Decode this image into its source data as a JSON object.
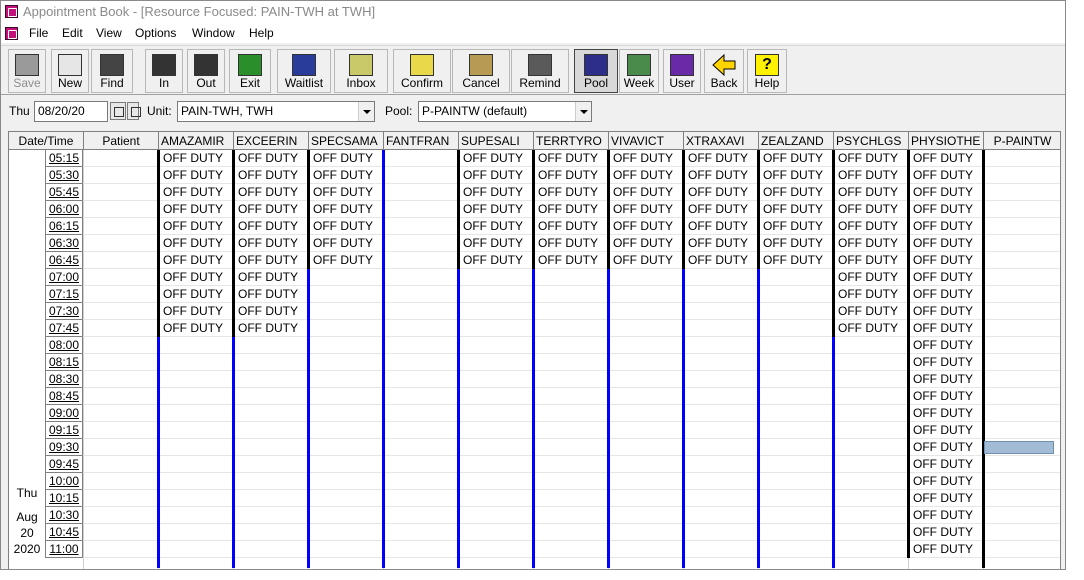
{
  "window": {
    "title": "Appointment Book - [Resource Focused:  PAIN-TWH at TWH]"
  },
  "menu": [
    "File",
    "Edit",
    "View",
    "Options",
    "Window",
    "Help"
  ],
  "toolbar": [
    {
      "label": "Save",
      "icon": "save-icon",
      "disabled": true
    },
    {
      "label": "New",
      "icon": "new-icon"
    },
    {
      "label": "Find",
      "icon": "binoculars-icon"
    },
    {
      "label": "In",
      "icon": "check-in-icon"
    },
    {
      "label": "Out",
      "icon": "check-out-icon"
    },
    {
      "label": "Exit",
      "icon": "exit-icon"
    },
    {
      "label": "Waitlist",
      "icon": "waitlist-icon"
    },
    {
      "label": "Inbox",
      "icon": "inbox-icon"
    },
    {
      "label": "Confirm",
      "icon": "confirm-icon"
    },
    {
      "label": "Cancel",
      "icon": "cancel-basket-icon"
    },
    {
      "label": "Remind",
      "icon": "remind-icon"
    },
    {
      "label": "Pool",
      "icon": "pool-grid-icon",
      "pressed": true
    },
    {
      "label": "Week",
      "icon": "week-grid-icon"
    },
    {
      "label": "User",
      "icon": "magnifier-icon"
    },
    {
      "label": "Back",
      "icon": "back-arrow-icon"
    },
    {
      "label": "Help",
      "icon": "help-question-icon"
    }
  ],
  "filters": {
    "day": "Thu",
    "date": "08/20/20",
    "unit_label": "Unit:",
    "unit_value": "PAIN-TWH, TWH",
    "pool_label": "Pool:",
    "pool_value": "P-PAINTW (default)"
  },
  "schedule": {
    "headers": {
      "datetime": "Date/Time",
      "patient": "Patient"
    },
    "resources": [
      "AMAZAMIR",
      "EXCEERIN",
      "SPECSAMA",
      "FANTFRAN",
      "SUPESALI",
      "TERRTYRO",
      "VIVAVICT",
      "XTRAXAVI",
      "ZEALZAND",
      "PSYCHLGS",
      "PHYSIOTHE",
      "P-PAINTW"
    ],
    "times": [
      "05:15",
      "05:30",
      "05:45",
      "06:00",
      "06:15",
      "06:30",
      "06:45",
      "07:00",
      "07:15",
      "07:30",
      "07:45",
      "08:00",
      "08:15",
      "08:30",
      "08:45",
      "09:00",
      "09:15",
      "09:30",
      "09:45",
      "10:00",
      "10:15",
      "10:30",
      "10:45",
      "11:00"
    ],
    "off_text": "OFF DUTY",
    "off_until": [
      11,
      11,
      7,
      0,
      7,
      7,
      7,
      7,
      7,
      11,
      24,
      0
    ],
    "day_info": {
      "weekday": "Thu",
      "month": "Aug",
      "day": "20",
      "year": "2020"
    }
  },
  "colors": {
    "accent_bar": "#0000ff",
    "off_bar": "#000000",
    "selection": "#a3bcd6"
  }
}
